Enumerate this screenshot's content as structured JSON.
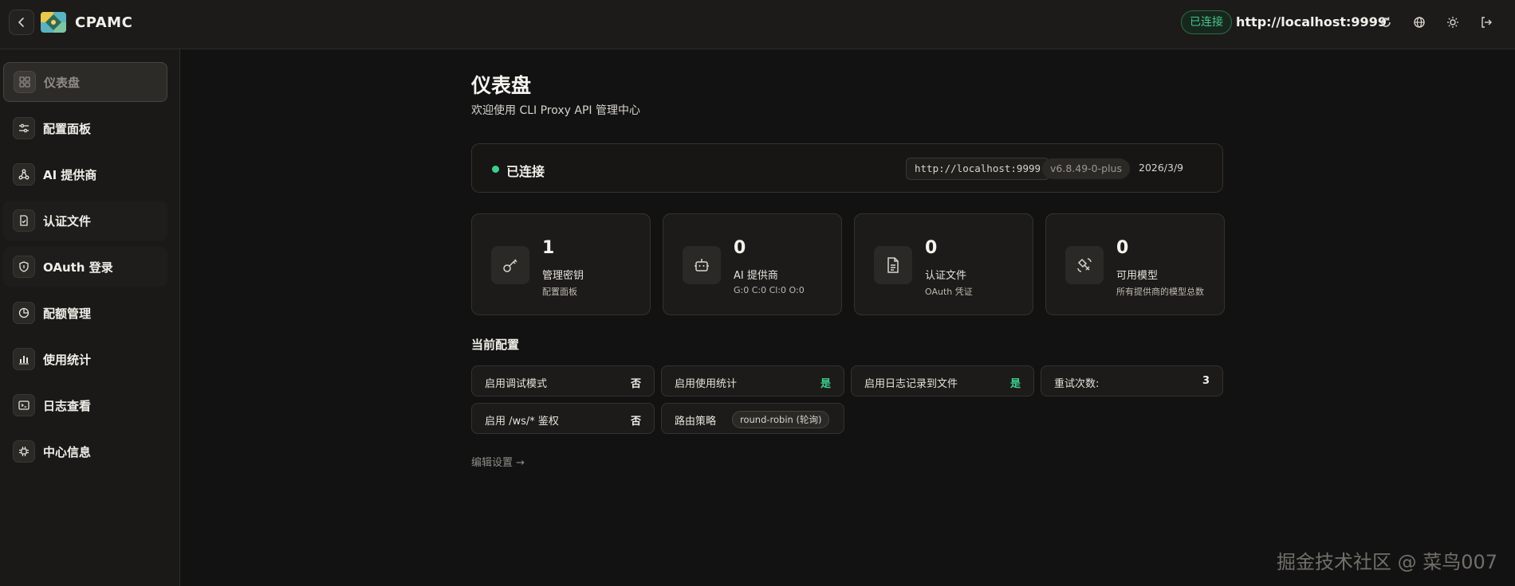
{
  "app": {
    "title": "CPAMC"
  },
  "header": {
    "status_badge": "已连接",
    "host_url": "http://localhost:9999",
    "icons": [
      "refresh-icon",
      "globe-icon",
      "sun-icon",
      "logout-icon"
    ]
  },
  "sidebar": {
    "items": [
      {
        "label": "仪表盘",
        "icon": "dashboard-icon",
        "active": true
      },
      {
        "label": "配置面板",
        "icon": "sliders-icon"
      },
      {
        "label": "AI 提供商",
        "icon": "network-icon"
      },
      {
        "label": "认证文件",
        "icon": "file-check-icon"
      },
      {
        "label": "OAuth 登录",
        "icon": "shield-icon"
      },
      {
        "label": "配额管理",
        "icon": "pie-icon"
      },
      {
        "label": "使用统计",
        "icon": "bar-chart-icon"
      },
      {
        "label": "日志查看",
        "icon": "terminal-icon"
      },
      {
        "label": "中心信息",
        "icon": "chip-icon"
      }
    ]
  },
  "main": {
    "title": "仪表盘",
    "subtitle": "欢迎使用 CLI Proxy API 管理中心",
    "status": {
      "text": "已连接",
      "url": "http://localhost:9999",
      "version": "v6.8.49-0-plus",
      "date": "2026/3/9"
    },
    "stats": [
      {
        "value": "1",
        "label": "管理密钥",
        "sub": "配置面板",
        "icon": "key-icon"
      },
      {
        "value": "0",
        "label": "AI 提供商",
        "sub": "G:0 C:0 Cl:0 O:0",
        "icon": "robot-icon"
      },
      {
        "value": "0",
        "label": "认证文件",
        "sub": "OAuth 凭证",
        "icon": "document-icon"
      },
      {
        "value": "0",
        "label": "可用模型",
        "sub": "所有提供商的模型总数",
        "icon": "satellite-icon"
      }
    ],
    "config": {
      "title": "当前配置",
      "items": [
        {
          "label": "启用调试模式",
          "value": "否"
        },
        {
          "label": "启用使用统计",
          "value": "是"
        },
        {
          "label": "启用日志记录到文件",
          "value": "是"
        },
        {
          "label": "重试次数:",
          "value": "3"
        },
        {
          "label": "启用 /ws/* 鉴权",
          "value": "否"
        },
        {
          "label": "路由策略",
          "value": "round-robin (轮询)"
        }
      ],
      "edit_link": "编辑设置 →"
    }
  },
  "colors": {
    "accent_green": "#3ecf8e",
    "background": "#121212"
  },
  "watermark": "掘金技术社区 @ 菜鸟007"
}
